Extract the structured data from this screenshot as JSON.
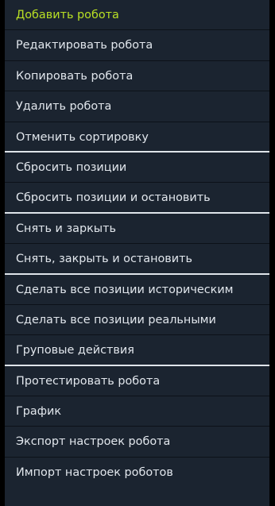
{
  "menu": {
    "highlight_color": "#b9e024",
    "items": [
      {
        "label": "Добавить робота",
        "highlight": true,
        "group_end": false
      },
      {
        "label": "Редактировать робота",
        "highlight": false,
        "group_end": false
      },
      {
        "label": "Копировать робота",
        "highlight": false,
        "group_end": false
      },
      {
        "label": "Удалить робота",
        "highlight": false,
        "group_end": false
      },
      {
        "label": "Отменить сортировку",
        "highlight": false,
        "group_end": true
      },
      {
        "label": "Сбросить позиции",
        "highlight": false,
        "group_end": false
      },
      {
        "label": "Сбросить позиции и остановить",
        "highlight": false,
        "group_end": true
      },
      {
        "label": "Снять и заркыть",
        "highlight": false,
        "group_end": false
      },
      {
        "label": "Снять, закрыть и остановить",
        "highlight": false,
        "group_end": true
      },
      {
        "label": "Сделать все позиции историческим",
        "highlight": false,
        "group_end": false
      },
      {
        "label": "Сделать все позиции реальными",
        "highlight": false,
        "group_end": false
      },
      {
        "label": "Груповые действия",
        "highlight": false,
        "group_end": true
      },
      {
        "label": "Протестировать робота",
        "highlight": false,
        "group_end": false
      },
      {
        "label": "График",
        "highlight": false,
        "group_end": false
      },
      {
        "label": "Экспорт настроек робота",
        "highlight": false,
        "group_end": false
      },
      {
        "label": "Импорт настроек роботов",
        "highlight": false,
        "group_end": false
      }
    ]
  }
}
